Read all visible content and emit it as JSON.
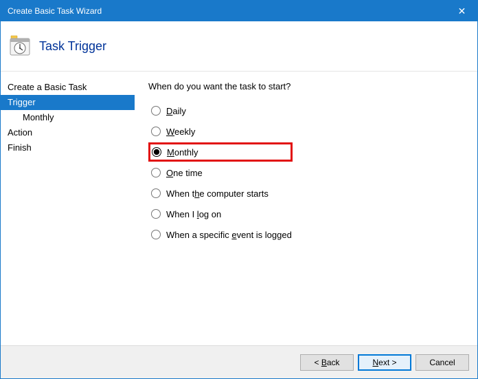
{
  "titlebar": {
    "title": "Create Basic Task Wizard",
    "close_icon": "✕"
  },
  "header": {
    "title": "Task Trigger"
  },
  "sidebar": {
    "items": [
      {
        "label": "Create a Basic Task",
        "active": false,
        "indent": false
      },
      {
        "label": "Trigger",
        "active": true,
        "indent": false
      },
      {
        "label": "Monthly",
        "active": false,
        "indent": true
      },
      {
        "label": "Action",
        "active": false,
        "indent": false
      },
      {
        "label": "Finish",
        "active": false,
        "indent": false
      }
    ]
  },
  "content": {
    "question": "When do you want the task to start?",
    "options": {
      "daily": {
        "prefix": "",
        "mn": "D",
        "rest": "aily"
      },
      "weekly": {
        "prefix": "",
        "mn": "W",
        "rest": "eekly"
      },
      "monthly": {
        "prefix": "",
        "mn": "M",
        "rest": "onthly"
      },
      "onetime": {
        "prefix": "",
        "mn": "O",
        "rest": "ne time"
      },
      "computerstarts": {
        "prefix": "When t",
        "mn": "h",
        "rest": "e computer starts"
      },
      "logon": {
        "prefix": "When I ",
        "mn": "l",
        "rest": "og on"
      },
      "event": {
        "prefix": "When a specific ",
        "mn": "e",
        "rest": "vent is logged"
      }
    },
    "selected": "monthly"
  },
  "footer": {
    "back": {
      "chevron": "<",
      "mn": "B",
      "rest": "ack"
    },
    "next": {
      "mn": "N",
      "rest": "ext",
      "chevron": ">"
    },
    "cancel": {
      "label": "Cancel"
    }
  }
}
